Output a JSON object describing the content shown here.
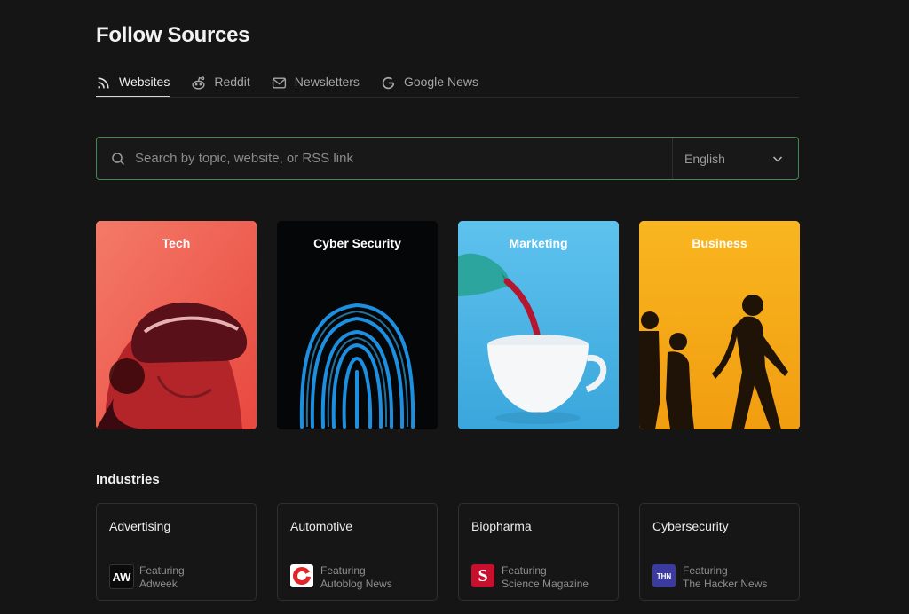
{
  "page": {
    "title": "Follow Sources"
  },
  "tabs": [
    {
      "label": "Websites",
      "icon": "rss-icon",
      "active": true
    },
    {
      "label": "Reddit",
      "icon": "reddit-icon",
      "active": false
    },
    {
      "label": "Newsletters",
      "icon": "mail-icon",
      "active": false
    },
    {
      "label": "Google News",
      "icon": "google-icon",
      "active": false
    }
  ],
  "search": {
    "placeholder": "Search by topic, website, or RSS link",
    "value": "",
    "language": "English"
  },
  "topics": [
    {
      "label": "Tech",
      "bg": "#f0675a"
    },
    {
      "label": "Cyber Security",
      "bg": "#050608"
    },
    {
      "label": "Marketing",
      "bg": "#4fb8e6"
    },
    {
      "label": "Business",
      "bg": "#f6b11b"
    }
  ],
  "industries": {
    "title": "Industries",
    "items": [
      {
        "name": "Advertising",
        "featuring": "Featuring",
        "source": "Adweek",
        "logo_text": "AW",
        "logo_bg": "#0b0b0b"
      },
      {
        "name": "Automotive",
        "featuring": "Featuring",
        "source": "Autoblog News",
        "logo_text": "",
        "logo_bg": "#ffffff"
      },
      {
        "name": "Biopharma",
        "featuring": "Featuring",
        "source": "Science Magazine",
        "logo_text": "S",
        "logo_bg": "#c8102e"
      },
      {
        "name": "Cybersecurity",
        "featuring": "Featuring",
        "source": "The Hacker News",
        "logo_text": "THN",
        "logo_bg": "#3b3a9e"
      }
    ]
  },
  "colors": {
    "accent_border": "#3f8a52",
    "background": "#151515"
  }
}
